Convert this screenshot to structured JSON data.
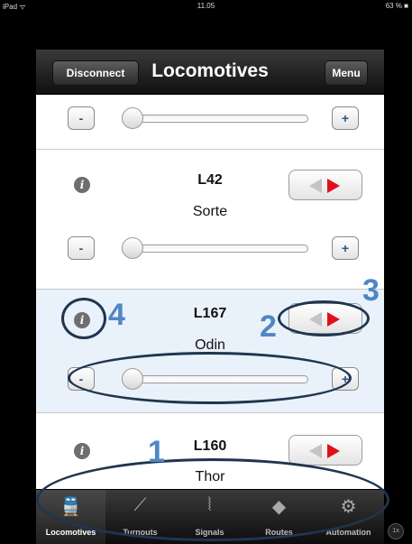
{
  "status_bar": {
    "carrier": "iPad ᯤ",
    "time": "11.05",
    "battery": "63 % ■"
  },
  "nav": {
    "left_button": "Disconnect",
    "title": "Locomotives",
    "right_button": "Menu"
  },
  "locomotives": [
    {
      "name": "",
      "label": "",
      "speed": 0
    },
    {
      "name": "L42",
      "label": "Sorte",
      "speed": 0
    },
    {
      "name": "L167",
      "label": "Odin",
      "speed": 0
    },
    {
      "name": "L160",
      "label": "Thor",
      "speed": 0
    }
  ],
  "controls": {
    "minus": "-",
    "plus": "+",
    "info": "i"
  },
  "tabs": [
    {
      "label": "Locomotives",
      "icon": "train-icon",
      "active": true
    },
    {
      "label": "Turnouts",
      "icon": "turnout-icon",
      "active": false
    },
    {
      "label": "Signals",
      "icon": "signal-icon",
      "active": false
    },
    {
      "label": "Routes",
      "icon": "route-icon",
      "active": false
    },
    {
      "label": "Automation",
      "icon": "gear-icon",
      "active": false
    }
  ],
  "tab_glyphs": {
    "train": "🚆",
    "turnout": "⟋",
    "signal": "⦚",
    "route": "◆",
    "gear": "⚙"
  },
  "callouts": {
    "one": "1",
    "two": "2",
    "three": "3",
    "four": "4"
  },
  "corner_badge": "1x",
  "colors": {
    "accent_red": "#e0101a",
    "callout_blue": "#4f86c6",
    "tab_active": "#4fb0ea"
  }
}
